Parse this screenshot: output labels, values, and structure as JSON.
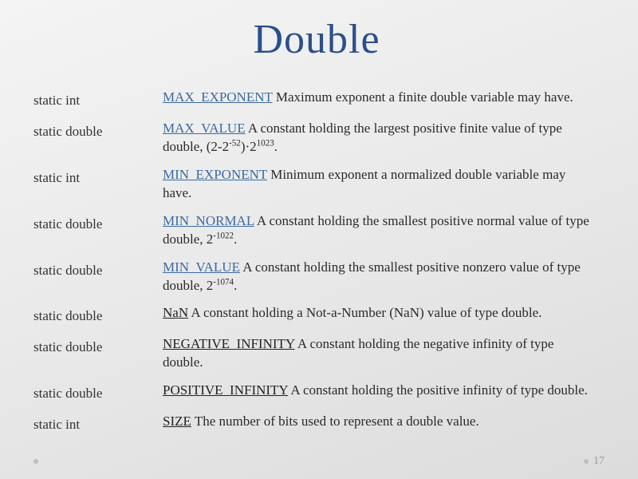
{
  "title": "Double",
  "rows": [
    {
      "type": "static int",
      "field": "MAX_EXPONENT",
      "link": true,
      "desc_before": "",
      "desc_after": " Maximum exponent a finite double variable may have.",
      "sup1": "",
      "mid": "",
      "sup2": "",
      "tail": ""
    },
    {
      "type": "static double",
      "field": "MAX_VALUE",
      "link": true,
      "desc_before": "",
      "desc_after": " A constant holding the largest positive finite value of type double, (2-2",
      "sup1": "-52",
      "mid": ")·2",
      "sup2": "1023",
      "tail": "."
    },
    {
      "type": "static int",
      "field": "MIN_EXPONENT",
      "link": true,
      "desc_before": "",
      "desc_after": " Minimum exponent a normalized double variable may have.",
      "sup1": "",
      "mid": "",
      "sup2": "",
      "tail": ""
    },
    {
      "type": "static double",
      "field": "MIN_NORMAL",
      "link": true,
      "desc_before": "",
      "desc_after": " A constant holding the smallest positive normal value of type double, 2",
      "sup1": "-1022",
      "mid": "",
      "sup2": "",
      "tail": "."
    },
    {
      "type": "static double",
      "field": "MIN_VALUE",
      "link": true,
      "desc_before": "",
      "desc_after": " A constant holding the smallest positive nonzero value of type double, 2",
      "sup1": "-1074",
      "mid": "",
      "sup2": "",
      "tail": "."
    },
    {
      "type": "static double",
      "field": "NaN",
      "link": false,
      "desc_before": "",
      "desc_after": " A constant holding a Not-a-Number (NaN) value of type double.",
      "sup1": "",
      "mid": "",
      "sup2": "",
      "tail": ""
    },
    {
      "type": "static double",
      "field": "NEGATIVE_INFINITY",
      "link": false,
      "desc_before": "",
      "desc_after": " A constant holding the negative infinity of type double.",
      "sup1": "",
      "mid": "",
      "sup2": "",
      "tail": ""
    },
    {
      "type": "static double",
      "field": "POSITIVE_INFINITY",
      "link": false,
      "desc_before": "",
      "desc_after": " A constant holding the positive infinity of type double.",
      "sup1": "",
      "mid": "",
      "sup2": "",
      "tail": ""
    },
    {
      "type": "static int",
      "field": "SIZE",
      "link": false,
      "desc_before": "",
      "desc_after": " The number of bits used to represent a double value.",
      "sup1": "",
      "mid": "",
      "sup2": "",
      "tail": ""
    }
  ],
  "page_number": "17"
}
